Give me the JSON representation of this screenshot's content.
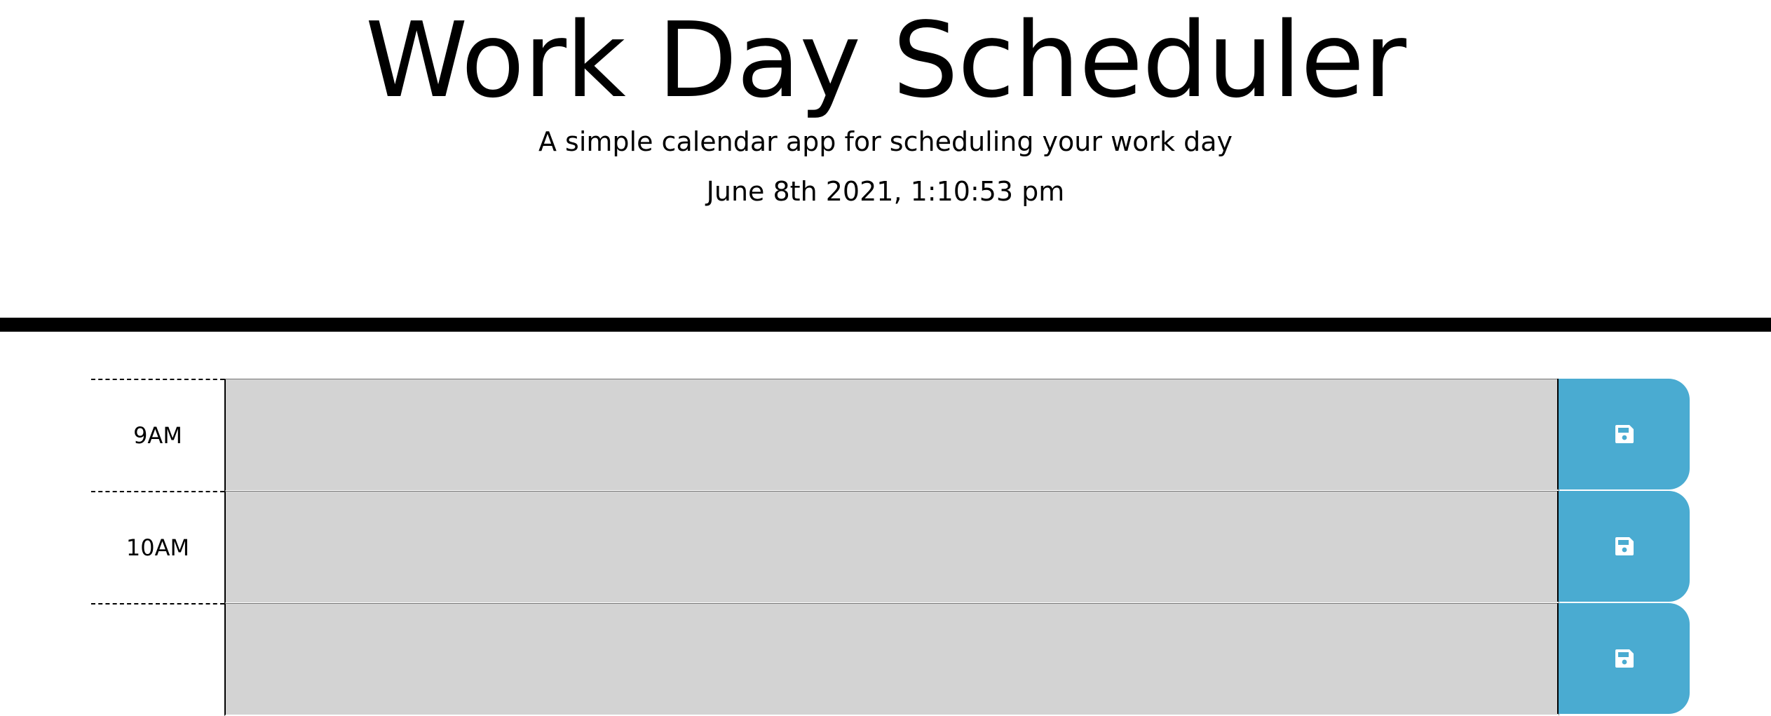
{
  "header": {
    "title": "Work Day Scheduler",
    "subtitle": "A simple calendar app for scheduling your work day",
    "current_datetime": "June 8th 2021, 1:10:53 pm"
  },
  "colors": {
    "past_block": "#d3d3d3",
    "save_button": "#4aabd1",
    "header_rule": "#000000"
  },
  "time_blocks": [
    {
      "hour": "9AM",
      "description": "",
      "save_icon": "floppy-disk-icon"
    },
    {
      "hour": "10AM",
      "description": "",
      "save_icon": "floppy-disk-icon"
    },
    {
      "hour": "",
      "description": "",
      "save_icon": "floppy-disk-icon"
    }
  ]
}
